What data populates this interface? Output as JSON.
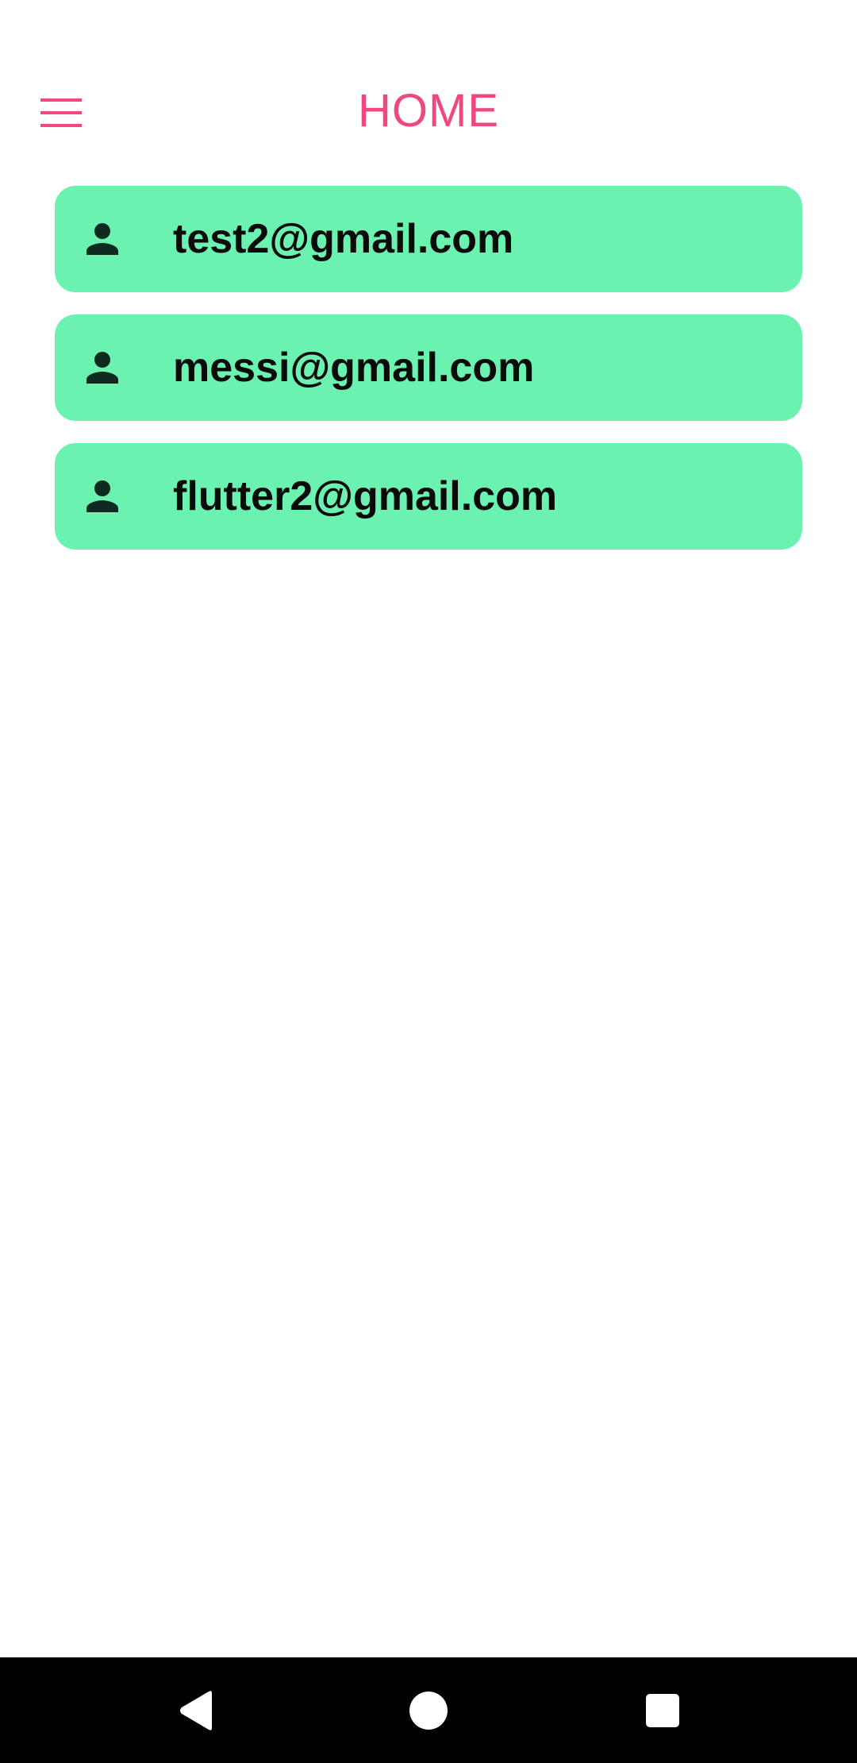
{
  "header": {
    "title": "HOME",
    "menu_icon": "hamburger-menu-icon",
    "title_color": "#f0477f"
  },
  "users": [
    {
      "email": "test2@gmail.com",
      "icon": "person-icon"
    },
    {
      "email": "messi@gmail.com",
      "icon": "person-icon"
    },
    {
      "email": "flutter2@gmail.com",
      "icon": "person-icon"
    }
  ],
  "theme": {
    "card_color": "#6cf2b0",
    "icon_color": "#0d2b20",
    "text_color": "#0b0b0b"
  },
  "nav_bar": {
    "buttons": [
      "back-icon",
      "home-icon",
      "recents-icon"
    ]
  }
}
